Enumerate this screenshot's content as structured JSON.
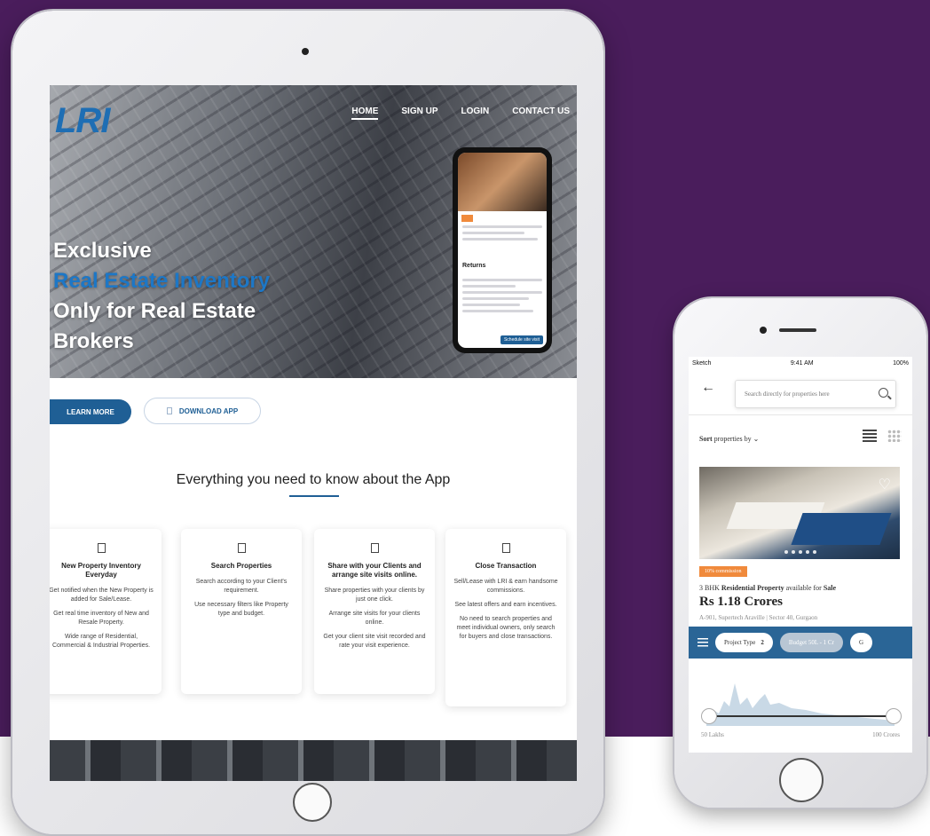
{
  "website": {
    "logo": "LRI",
    "logo_tagline": "",
    "nav": [
      "HOME",
      "SIGN UP",
      "LOGIN",
      "CONTACT US"
    ],
    "hero": {
      "line1": "Exclusive",
      "line2": "Real Estate Inventory",
      "line3": "Only for Real Estate",
      "line4": "Brokers"
    },
    "learn_more": "LEARN MORE",
    "download_app": "DOWNLOAD APP",
    "section_title": "Everything you need to know about the App",
    "cards": [
      {
        "title": "New Property Inventory Everyday",
        "lines": [
          "Get notified when the New Property is added for Sale/Lease.",
          "Get real time inventory of New and Resale Property.",
          "Wide range of Residential, Commercial & Industrial Properties."
        ]
      },
      {
        "title": "Search Properties",
        "lines": [
          "Search according to your Client's requirement.",
          "Use necessary filters like Property type and budget."
        ]
      },
      {
        "title": "Share with your Clients and arrange site visits online.",
        "lines": [
          "Share properties with your clients by just one click.",
          "Arrange site visits for your clients online.",
          "Get your client site visit recorded and rate your visit experience."
        ]
      },
      {
        "title": "Close Transaction",
        "lines": [
          "Sell/Lease with LRI & earn handsome commissions.",
          "See latest offers and earn incentives.",
          "No need to search properties and meet individual owners, only search for buyers and close transactions."
        ]
      }
    ]
  },
  "mini_phone": {
    "heading": "Returns",
    "button": "Schedule site visit"
  },
  "phone": {
    "status": {
      "carrier": "Sketch",
      "time": "9:41 AM",
      "battery": "100%"
    },
    "search_placeholder": "Search directly for properties here",
    "sort_bold": "Sort",
    "sort_rest": "properties by",
    "commission": "10% commission",
    "property_bhk": "3 BHK",
    "property_type": "Residential Property",
    "available_for": "available for",
    "property_for": "Sale",
    "price": "Rs 1.18 Crores",
    "address": "A-901, Supertech Araville | Sector 40, Gurgaon",
    "filters": [
      {
        "label": "Project Type",
        "count": "2"
      },
      {
        "label": "Budget 50L - 1 Cr"
      },
      {
        "label": "G"
      }
    ],
    "range_min": "50 Lakhs",
    "range_max": "100 Crores"
  },
  "colors": {
    "background": "#4a1d5c",
    "brand_blue": "#1f5f95",
    "commission_orange": "#f08a3c"
  }
}
